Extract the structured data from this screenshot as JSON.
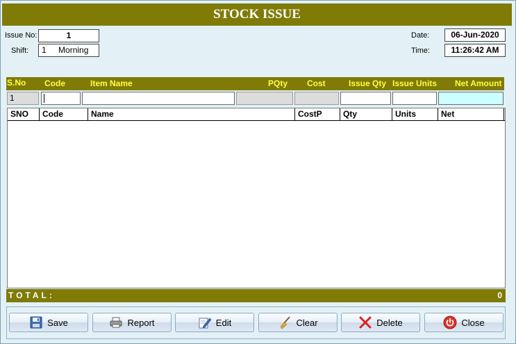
{
  "title": "STOCK ISSUE",
  "header": {
    "issue_no_label": "Issue No:",
    "issue_no": "1",
    "shift_label": "Shift:",
    "shift_no": "1",
    "shift_name": "Morning",
    "date_label": "Date:",
    "date": "06-Jun-2020",
    "time_label": "Time:",
    "time": "11:26:42 AM"
  },
  "entry": {
    "columns": [
      "S.No",
      "Code",
      "Item Name",
      "PQty",
      "Cost",
      "Issue Qty",
      "Issue Units",
      "Net Amount"
    ],
    "sno_value": "1"
  },
  "grid": {
    "columns": [
      "SNO",
      "Code",
      "Name",
      "CostP",
      "Qty",
      "Units",
      "Net"
    ],
    "rows": []
  },
  "total": {
    "label": "TOTAL:",
    "value": "0"
  },
  "buttons": {
    "save": "Save",
    "report": "Report",
    "edit": "Edit",
    "clear": "Clear",
    "delete": "Delete",
    "close": "Close"
  },
  "colors": {
    "bar": "#7f7b06",
    "bar_text": "#ffff40",
    "background": "#e3f1f6"
  }
}
